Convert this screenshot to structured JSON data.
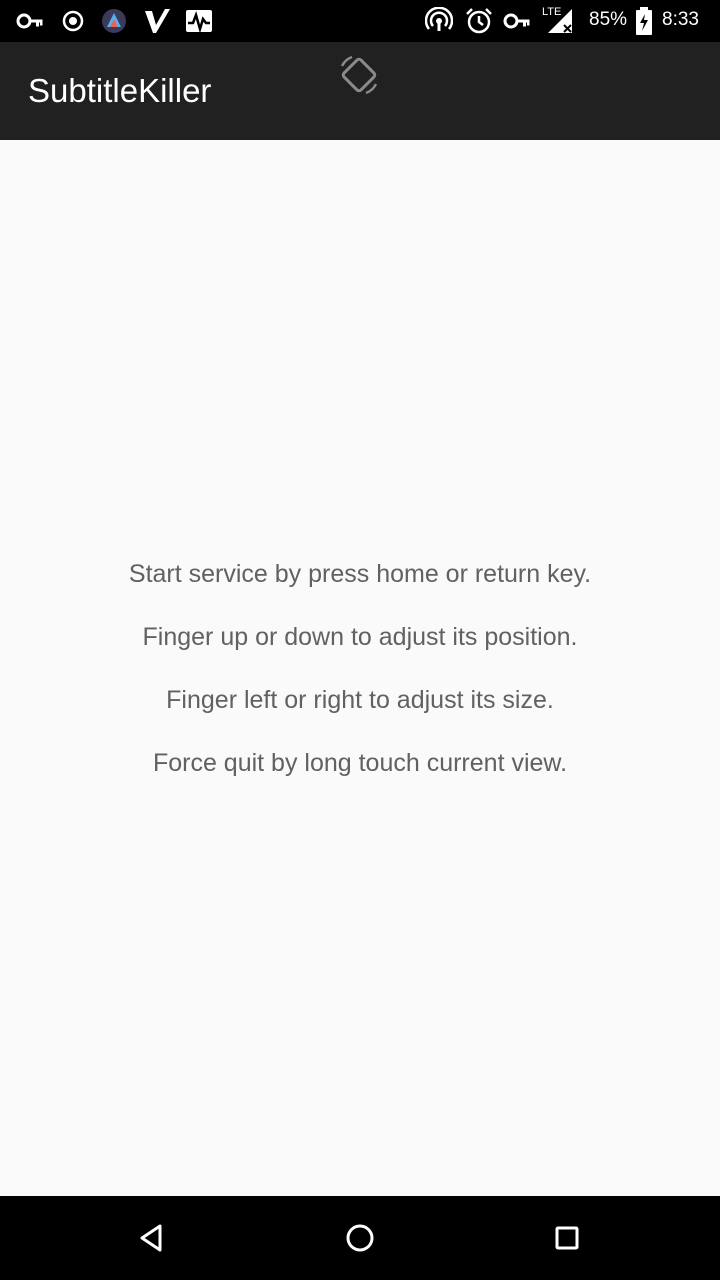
{
  "status_bar": {
    "icons": [
      "vpn-key-icon",
      "record-icon",
      "app-notification-icon",
      "v-app-icon",
      "activity-icon",
      "hotspot-icon",
      "alarm-icon",
      "vpn-key-icon",
      "lte-signal-icon",
      "battery-charging-icon"
    ],
    "network_label": "LTE",
    "battery_percent": "85%",
    "time": "8:33"
  },
  "app_bar": {
    "title": "SubtitleKiller",
    "rotate_icon": "screen-rotation-icon"
  },
  "content": {
    "lines": [
      "Start service by press home or return key.",
      "Finger up or down to adjust its position.",
      "Finger left or right to adjust its size.",
      "Force quit by long touch current view."
    ]
  },
  "nav_bar": {
    "buttons": [
      "back-icon",
      "home-icon",
      "recents-icon"
    ]
  },
  "colors": {
    "status_bar": "#000000",
    "app_bar": "#212121",
    "background": "#fafafa",
    "text": "#616161"
  }
}
